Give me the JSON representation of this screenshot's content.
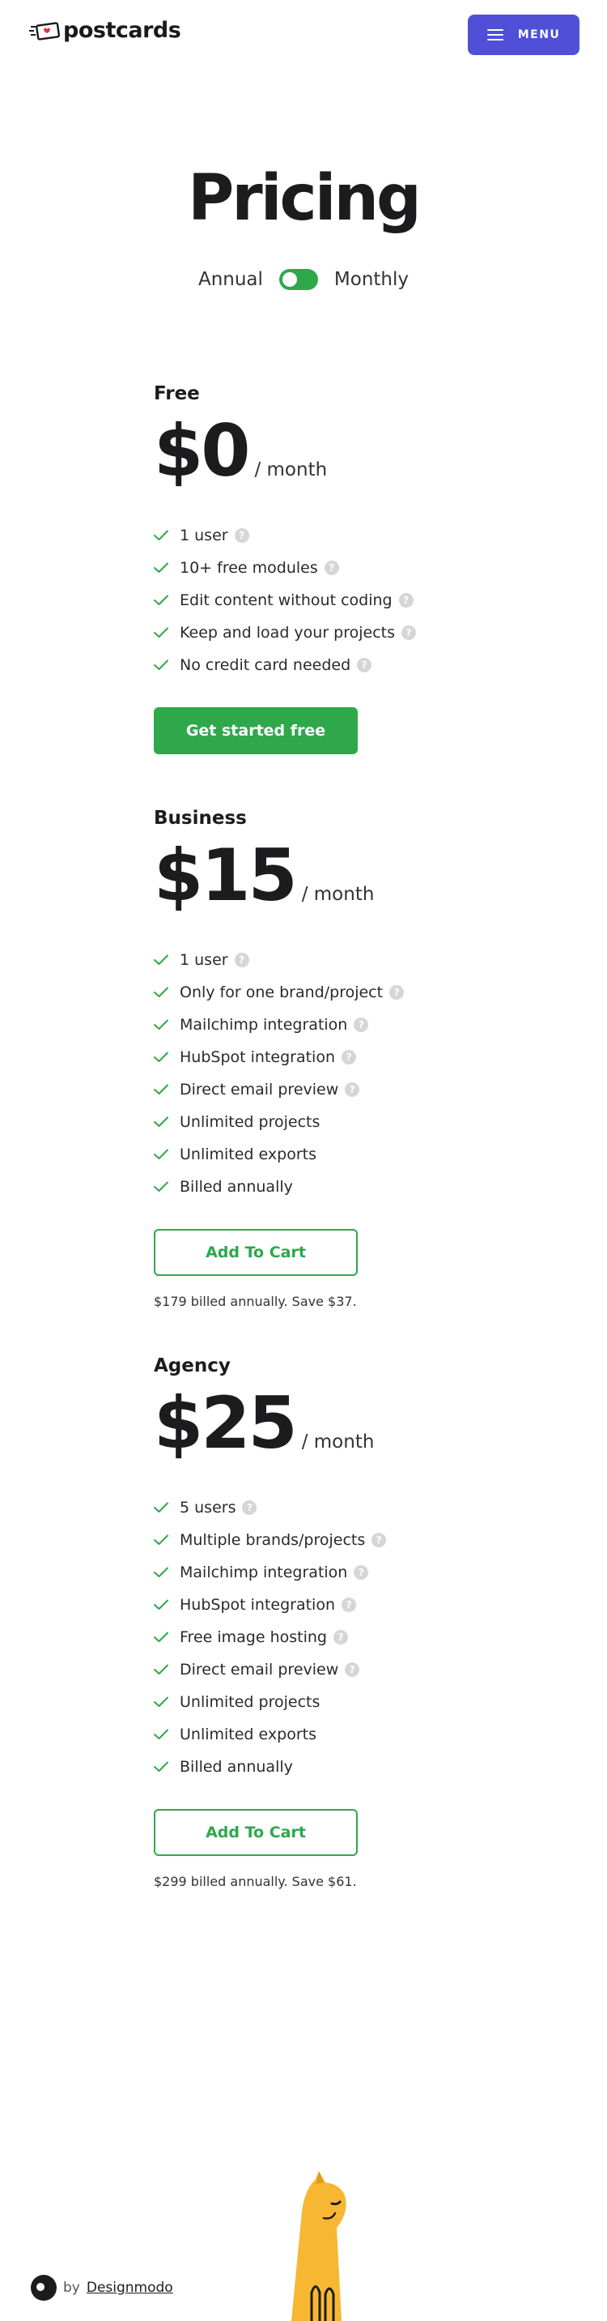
{
  "header": {
    "logo_text": "postcards",
    "menu_label": "MENU"
  },
  "page": {
    "title": "Pricing",
    "billing_annual": "Annual",
    "billing_monthly": "Monthly"
  },
  "plans": [
    {
      "name": "Free",
      "price": "$0",
      "period": "/ month",
      "features": [
        {
          "text": "1 user",
          "help": true
        },
        {
          "text": "10+ free modules",
          "help": true
        },
        {
          "text": "Edit content without coding",
          "help": true
        },
        {
          "text": "Keep and load your projects",
          "help": true
        },
        {
          "text": "No credit card needed",
          "help": true
        }
      ],
      "button": "Get started free",
      "note": ""
    },
    {
      "name": "Business",
      "price": "$15",
      "period": "/ month",
      "features": [
        {
          "text": "1 user",
          "help": true
        },
        {
          "text": "Only for one brand/project",
          "help": true
        },
        {
          "text": "Mailchimp integration",
          "help": true
        },
        {
          "text": "HubSpot integration",
          "help": true
        },
        {
          "text": "Direct email preview",
          "help": true
        },
        {
          "text": "Unlimited projects",
          "help": false
        },
        {
          "text": "Unlimited exports",
          "help": false
        },
        {
          "text": "Billed annually",
          "help": false
        }
      ],
      "button": "Add To Cart",
      "note": "$179 billed annually. Save $37."
    },
    {
      "name": "Agency",
      "price": "$25",
      "period": "/ month",
      "features": [
        {
          "text": "5 users",
          "help": true
        },
        {
          "text": "Multiple brands/projects",
          "help": true
        },
        {
          "text": "Mailchimp integration",
          "help": true
        },
        {
          "text": "HubSpot integration",
          "help": true
        },
        {
          "text": "Free image hosting",
          "help": true
        },
        {
          "text": "Direct email preview",
          "help": true
        },
        {
          "text": "Unlimited projects",
          "help": false
        },
        {
          "text": "Unlimited exports",
          "help": false
        },
        {
          "text": "Billed annually",
          "help": false
        }
      ],
      "button": "Add To Cart",
      "note": "$299 billed annually. Save $61."
    }
  ],
  "footer": {
    "by": "by",
    "link": "Designmodo"
  },
  "colors": {
    "accent_green": "#2ea84a",
    "menu_blue": "#4f4fd8",
    "cat_yellow": "#f7b733"
  },
  "icons": {
    "check": "check-icon",
    "help": "help-icon",
    "menu": "hamburger-icon"
  }
}
